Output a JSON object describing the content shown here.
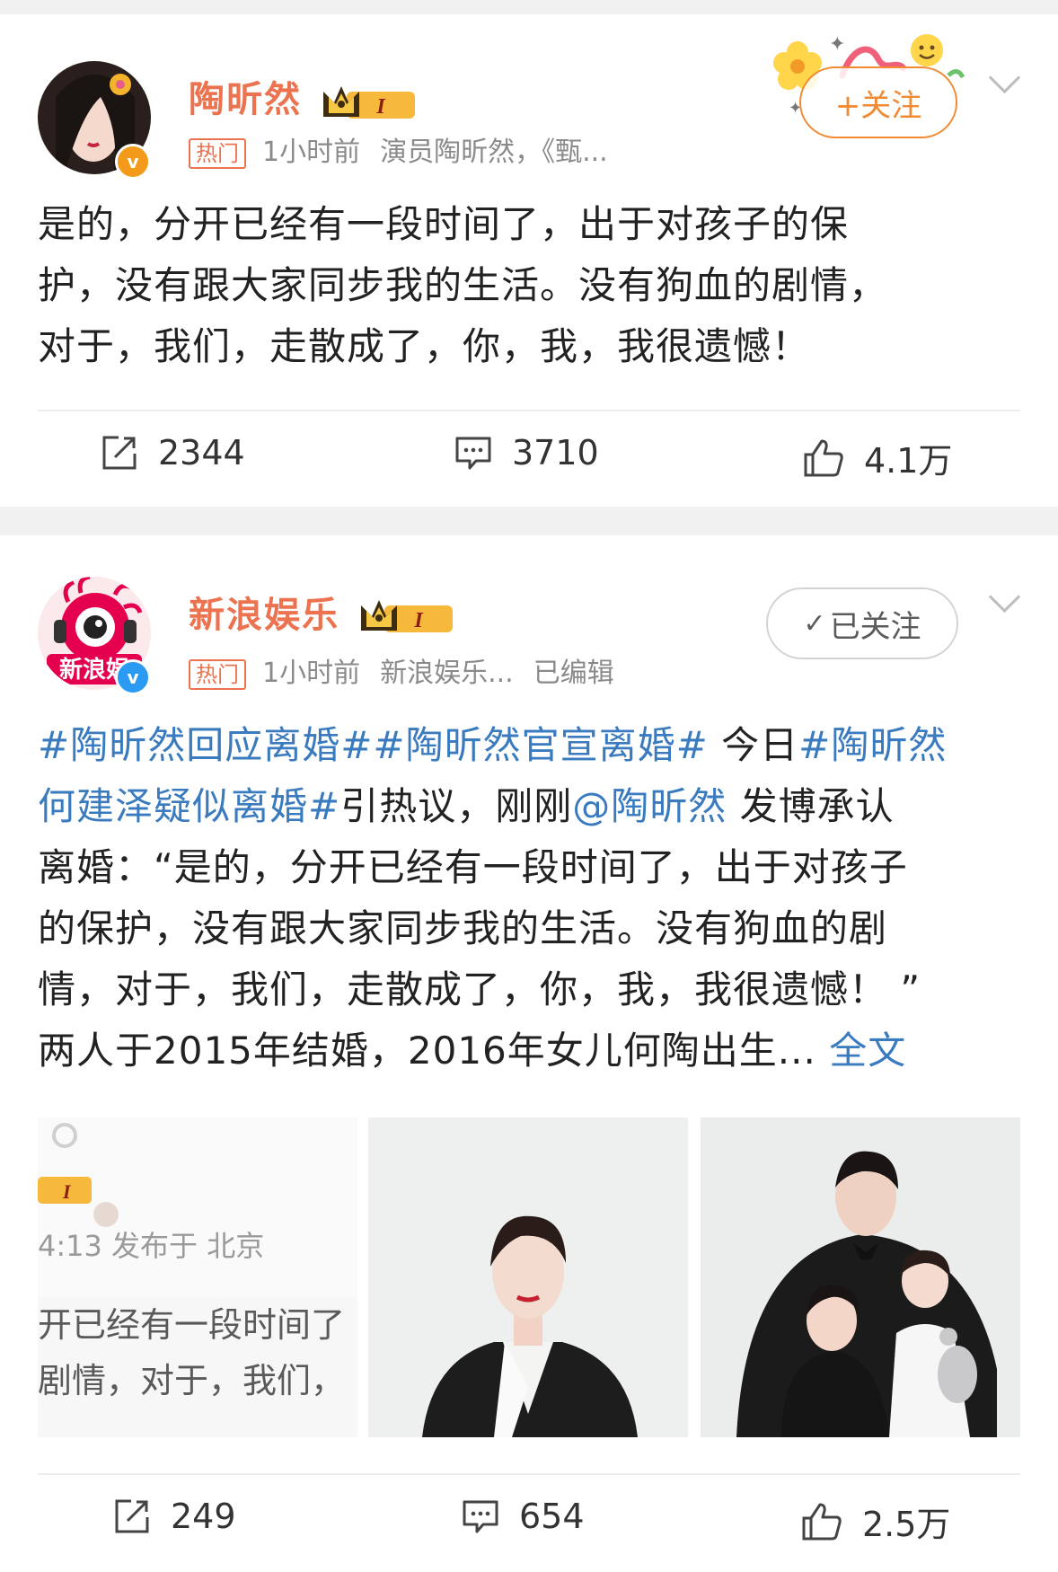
{
  "post1": {
    "author": "陶昕然",
    "level": "I",
    "hot_label": "热门",
    "time": "1小时前",
    "meta_extra": "演员陶昕然，《甄...",
    "follow_label": "+关注",
    "text_lines": [
      "是的，分开已经有一段时间了，出于对孩子的保",
      "护，没有跟大家同步我的生活。没有狗血的剧情，",
      "对于，我们，走散成了，你，我，我很遗憾！"
    ],
    "repost": "2344",
    "comment": "3710",
    "like": "4.1万"
  },
  "post2": {
    "author": "新浪娱乐",
    "level": "I",
    "hot_label": "热门",
    "time": "1小时前",
    "meta_extra": "新浪娱乐...",
    "edited": "已编辑",
    "follow_label": "已关注",
    "text": {
      "l1_tag": "#陶昕然回应离婚##陶昕然官宣离婚#",
      "l1_text": " 今日",
      "l1_tag2": "#陶昕然",
      "l2_tag": "何建泽疑似离婚#",
      "l2_text": "引热议，刚刚",
      "l2_mention": "@陶昕然",
      "l2_text2": " 发博承认",
      "l3": "离婚：“是的，分开已经有一段时间了，出于对孩子",
      "l4": "的保护，没有跟大家同步我的生活。没有狗血的剧",
      "l5": "情，对于，我们，走散成了，你，我，我很遗憾！ ”",
      "l6": "两人于2015年结婚，2016年女儿何陶出生...",
      "full_text_link": "全文"
    },
    "thumb1": {
      "level": "I",
      "time_location": "4:13 发布于 北京",
      "line1": "开已经有一段时间了",
      "line2": "剧情，对于，我们，"
    },
    "repost": "249",
    "comment": "654",
    "like": "2.5万"
  },
  "colors": {
    "name": "#eb7350",
    "topic": "#3a7bbf",
    "follow_orange": "#f28a33",
    "verified_orange": "#f39a1b",
    "verified_blue": "#2b9af3"
  }
}
